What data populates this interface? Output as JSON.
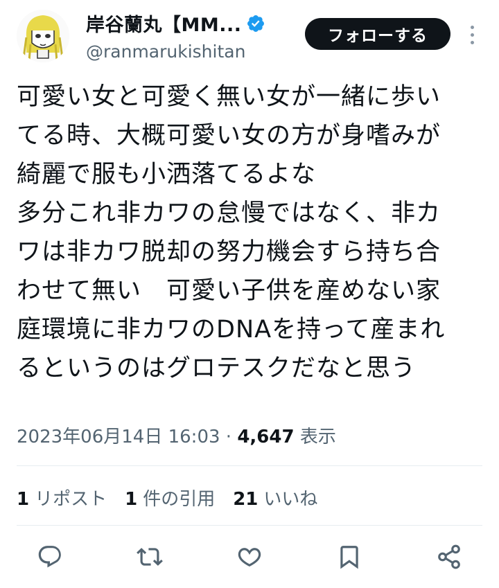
{
  "author": {
    "display_name": "岸谷蘭丸【MM...",
    "handle": "@ranmarukishitan",
    "verified": true,
    "verified_color": "#1d9bf0"
  },
  "follow_button": {
    "label": "フォローする"
  },
  "tweet": {
    "lines": [
      "可愛い女と可愛く無い女が一緒に歩い",
      "てる時、大概可愛い女の方が身嗜みが",
      "綺麗で服も小洒落てるよな",
      "多分これ非カワの怠慢ではなく、非カ",
      "ワは非カワ脱却の努力機会すら持ち合",
      "わせて無い　可愛い子供を産めない家",
      "庭環境に非カワのDNAを持って産まれ",
      "るというのはグロテスクだなと思う"
    ]
  },
  "meta": {
    "timestamp": "2023年06月14日 16:03",
    "separator": " · ",
    "views_count": "4,647",
    "views_label": " 表示"
  },
  "stats": {
    "reposts": {
      "count": "1",
      "label": "リポスト"
    },
    "quotes": {
      "count": "1",
      "label": "件の引用"
    },
    "likes": {
      "count": "21",
      "label": "いいね"
    }
  },
  "actions": [
    "reply-icon",
    "retweet-icon",
    "like-icon",
    "bookmark-icon",
    "share-icon"
  ],
  "colors": {
    "icon": "#536471",
    "text": "#0f1419",
    "muted": "#536471"
  }
}
